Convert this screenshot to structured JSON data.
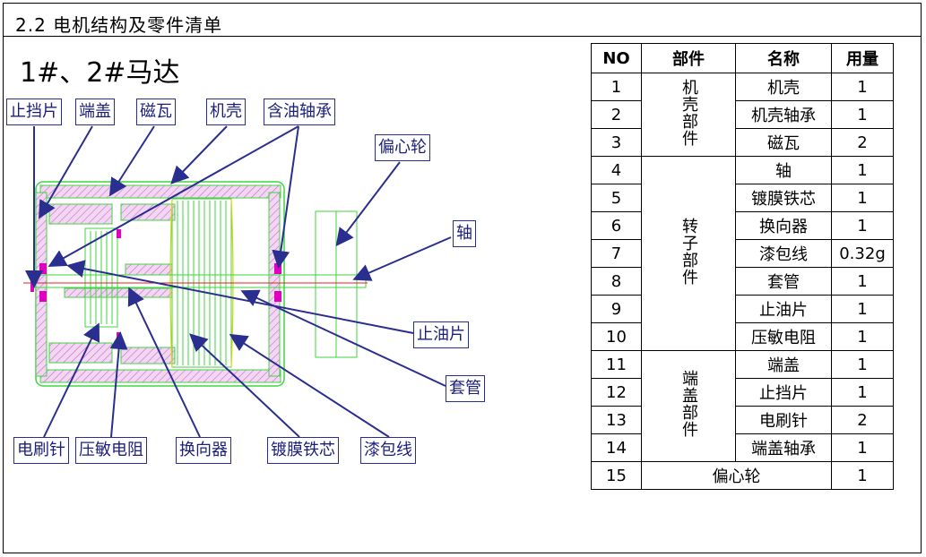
{
  "header": {
    "title": "2.2 电机结构及零件清单"
  },
  "diagram": {
    "subtitle": "1#、2#马达",
    "callouts": {
      "stop_plate": "止挡片",
      "end_cap": "端盖",
      "magnet": "磁瓦",
      "housing": "机壳",
      "oil_bearing": "含油轴承",
      "eccentric_wheel": "偏心轮",
      "shaft": "轴",
      "oil_stop": "止油片",
      "sleeve": "套管",
      "brush_pin": "电刷针",
      "varistor": "压敏电阻",
      "commutator": "换向器",
      "core": "镀膜铁芯",
      "enamel_wire": "漆包线"
    }
  },
  "parts_table": {
    "headers": {
      "no": "NO",
      "group": "部件",
      "name": "名称",
      "qty": "用量"
    },
    "groups": {
      "housing": "机壳部件",
      "rotor": "转子部件",
      "endcap": "端盖部件"
    },
    "rows": [
      {
        "no": "1",
        "name": "机壳",
        "qty": "1"
      },
      {
        "no": "2",
        "name": "机壳轴承",
        "qty": "1"
      },
      {
        "no": "3",
        "name": "磁瓦",
        "qty": "2"
      },
      {
        "no": "4",
        "name": "轴",
        "qty": "1"
      },
      {
        "no": "5",
        "name": "镀膜铁芯",
        "qty": "1"
      },
      {
        "no": "6",
        "name": "换向器",
        "qty": "1"
      },
      {
        "no": "7",
        "name": "漆包线",
        "qty": "0.32g"
      },
      {
        "no": "8",
        "name": "套管",
        "qty": "1"
      },
      {
        "no": "9",
        "name": "止油片",
        "qty": "1"
      },
      {
        "no": "10",
        "name": "压敏电阻",
        "qty": "1"
      },
      {
        "no": "11",
        "name": "端盖",
        "qty": "1"
      },
      {
        "no": "12",
        "name": "止挡片",
        "qty": "1"
      },
      {
        "no": "13",
        "name": "电刷针",
        "qty": "2"
      },
      {
        "no": "14",
        "name": "端盖轴承",
        "qty": "1"
      },
      {
        "no": "15",
        "name": "偏心轮",
        "qty": "1"
      }
    ]
  },
  "colors": {
    "callout_text": "#1b1f7a",
    "arrow": "#2a2f8f",
    "housing_fill": "#e6b8e6",
    "outline_green": "#3fd63f",
    "bearing_magenta": "#e000c0",
    "axis_red": "#e02020"
  }
}
